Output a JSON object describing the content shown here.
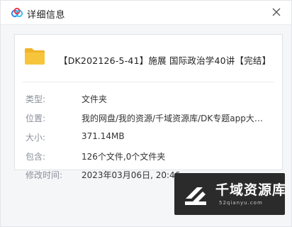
{
  "window": {
    "title": "详细信息",
    "close_icon": "close-icon",
    "app_icon": "cloud-logo-icon"
  },
  "file": {
    "icon": "folder-icon",
    "icon_color": "#f7c53b",
    "name": "【DK202126-5-41】施展 国际政治学40讲【完结】"
  },
  "details": [
    {
      "key": "type",
      "label": "类型:",
      "value": "文件夹"
    },
    {
      "key": "location",
      "label": "位置:",
      "value": "我的网盘/我的资源/千域资源库/DK专题app大课..."
    },
    {
      "key": "size",
      "label": "大小:",
      "value": "371.14MB"
    },
    {
      "key": "contains",
      "label": "包含:",
      "value": "126个文件,0个文件夹"
    },
    {
      "key": "modified",
      "label": "修改时间:",
      "value": "2023年03月06日, 20:46"
    }
  ],
  "watermark": {
    "brand": "千域资源库",
    "url": "52qianyu.com",
    "background": "#2b2b2b"
  }
}
